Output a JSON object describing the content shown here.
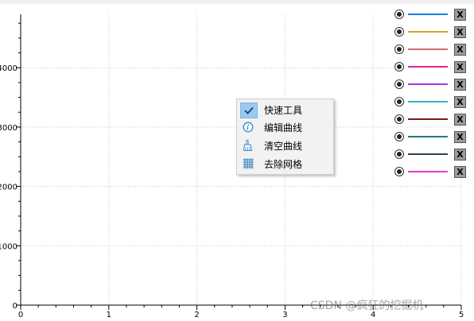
{
  "chart_data": {
    "type": "line",
    "x_ticks": [
      "0",
      "1",
      "2",
      "3",
      "4",
      "5"
    ],
    "y_ticks": [
      "0",
      "1000",
      "2000",
      "3000",
      "4000"
    ],
    "xlim": [
      0,
      5
    ],
    "ylim": [
      0,
      4900
    ],
    "grid": true,
    "legend_placement": "top-right",
    "series": [
      {
        "color": "#1a7fe3",
        "values": []
      },
      {
        "color": "#d9a22e",
        "values": []
      },
      {
        "color": "#d86a6a",
        "values": []
      },
      {
        "color": "#e8249b",
        "values": []
      },
      {
        "color": "#9b3cd8",
        "values": []
      },
      {
        "color": "#2ab6b8",
        "values": []
      },
      {
        "color": "#7a1a1a",
        "values": []
      },
      {
        "color": "#1a7f80",
        "values": []
      },
      {
        "color": "#27455a",
        "values": []
      },
      {
        "color": "#e43ad6",
        "values": []
      }
    ]
  },
  "legend": {
    "close_label": "X",
    "items": [
      {
        "color": "#1a7fe3",
        "icon": "radio-selected-icon"
      },
      {
        "color": "#d9a22e",
        "icon": "radio-selected-icon"
      },
      {
        "color": "#d86a6a",
        "icon": "radio-selected-icon"
      },
      {
        "color": "#e8249b",
        "icon": "radio-selected-icon"
      },
      {
        "color": "#9b3cd8",
        "icon": "radio-selected-icon"
      },
      {
        "color": "#2ab6b8",
        "icon": "radio-selected-icon"
      },
      {
        "color": "#7a1a1a",
        "icon": "radio-selected-icon"
      },
      {
        "color": "#1a7f80",
        "icon": "radio-selected-icon"
      },
      {
        "color": "#27455a",
        "icon": "radio-selected-icon"
      },
      {
        "color": "#e43ad6",
        "icon": "radio-selected-icon"
      }
    ]
  },
  "context_menu": {
    "items": [
      {
        "label": "快速工具",
        "icon": "checkmark-icon",
        "checked": true
      },
      {
        "label": "编辑曲线",
        "icon": "info-icon",
        "checked": false
      },
      {
        "label": "清空曲线",
        "icon": "brush-icon",
        "checked": false
      },
      {
        "label": "去除网格",
        "icon": "grid-icon",
        "checked": false
      }
    ]
  },
  "watermark": "CSDN @疯狂的挖掘机"
}
